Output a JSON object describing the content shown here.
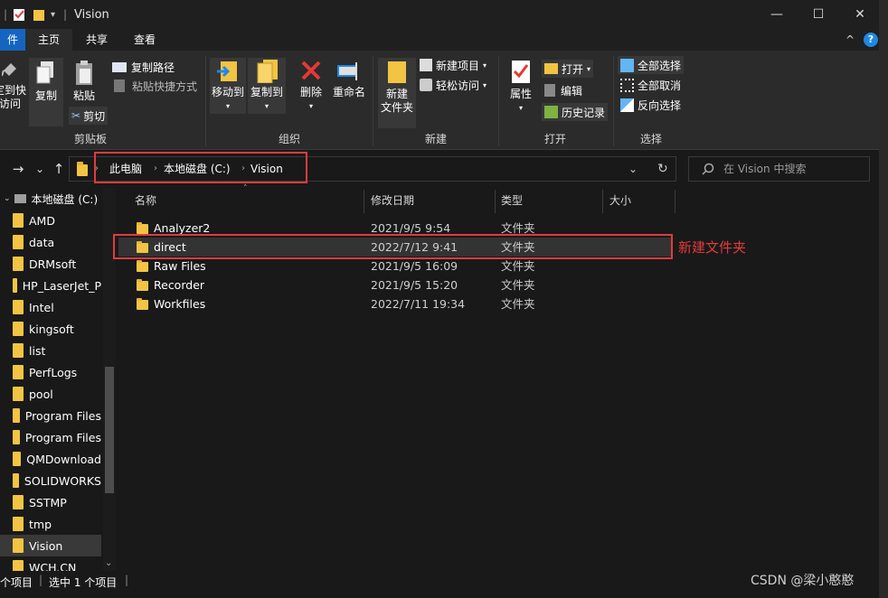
{
  "window": {
    "title": "Vision",
    "quick_access_sep": "|",
    "qa_dropdown": "▾",
    "controls": {
      "minimize": "—",
      "maximize": "☐",
      "close": "✕"
    },
    "collapse": "^",
    "help": "?"
  },
  "tabs": [
    {
      "label": "件"
    },
    {
      "label": "主页"
    },
    {
      "label": "共享"
    },
    {
      "label": "查看"
    }
  ],
  "ribbon": {
    "clipboard": {
      "pin_label_1": "定到快",
      "pin_label_2": "访问",
      "copy": "复制",
      "paste": "粘贴",
      "copy_path": "复制路径",
      "paste_shortcut": "粘贴快捷方式",
      "cut": "剪切",
      "group_label": "剪贴板"
    },
    "organize": {
      "move_to": "移动到",
      "copy_to": "复制到",
      "delete": "删除",
      "rename": "重命名",
      "group_label": "组织"
    },
    "new": {
      "new_folder_1": "新建",
      "new_folder_2": "文件夹",
      "new_item": "新建项目",
      "easy_access": "轻松访问",
      "group_label": "新建"
    },
    "open": {
      "properties": "属性",
      "open": "打开",
      "edit": "编辑",
      "history": "历史记录",
      "group_label": "打开"
    },
    "select": {
      "select_all": "全部选择",
      "select_none": "全部取消",
      "invert": "反向选择",
      "group_label": "选择"
    }
  },
  "navigation": {
    "back": "→",
    "dropdown": "⌄",
    "up": "↑",
    "breadcrumb": [
      "此电脑",
      "本地磁盘 (C:)",
      "Vision"
    ],
    "addr_dropdown": "⌄",
    "refresh": "↻",
    "search_placeholder": "在 Vision 中搜索"
  },
  "nav_pane": {
    "drive": "本地磁盘 (C:)",
    "items": [
      "AMD",
      "data",
      "DRMsoft",
      "HP_LaserJet_P",
      "Intel",
      "kingsoft",
      "list",
      "PerfLogs",
      "pool",
      "Program Files",
      "Program Files",
      "QMDownload",
      "SOLIDWORKS",
      "SSTMP",
      "tmp",
      "Vision",
      "WCH.CN"
    ],
    "selected": "Vision"
  },
  "file_list": {
    "columns": {
      "name": "名称",
      "date": "修改日期",
      "type": "类型",
      "size": "大小"
    },
    "rows": [
      {
        "name": "Analyzer2",
        "date": "2021/9/5 9:54",
        "type": "文件夹"
      },
      {
        "name": "direct",
        "date": "2022/7/12 9:41",
        "type": "文件夹"
      },
      {
        "name": "Raw Files",
        "date": "2021/9/5 16:09",
        "type": "文件夹"
      },
      {
        "name": "Recorder",
        "date": "2021/9/5 15:20",
        "type": "文件夹"
      },
      {
        "name": "Workfiles",
        "date": "2022/7/11 19:34",
        "type": "文件夹"
      }
    ],
    "selected_row": "direct"
  },
  "annotation": {
    "text": "新建文件夹",
    "color": "#e33b3b"
  },
  "status_bar": {
    "count": "个项目",
    "selected": "选中 1 个项目"
  },
  "watermark": "CSDN @梁小憨憨",
  "colors": {
    "accent": "#1565c0",
    "folder": "#f3c443",
    "highlight_box": "#e23b3b"
  }
}
